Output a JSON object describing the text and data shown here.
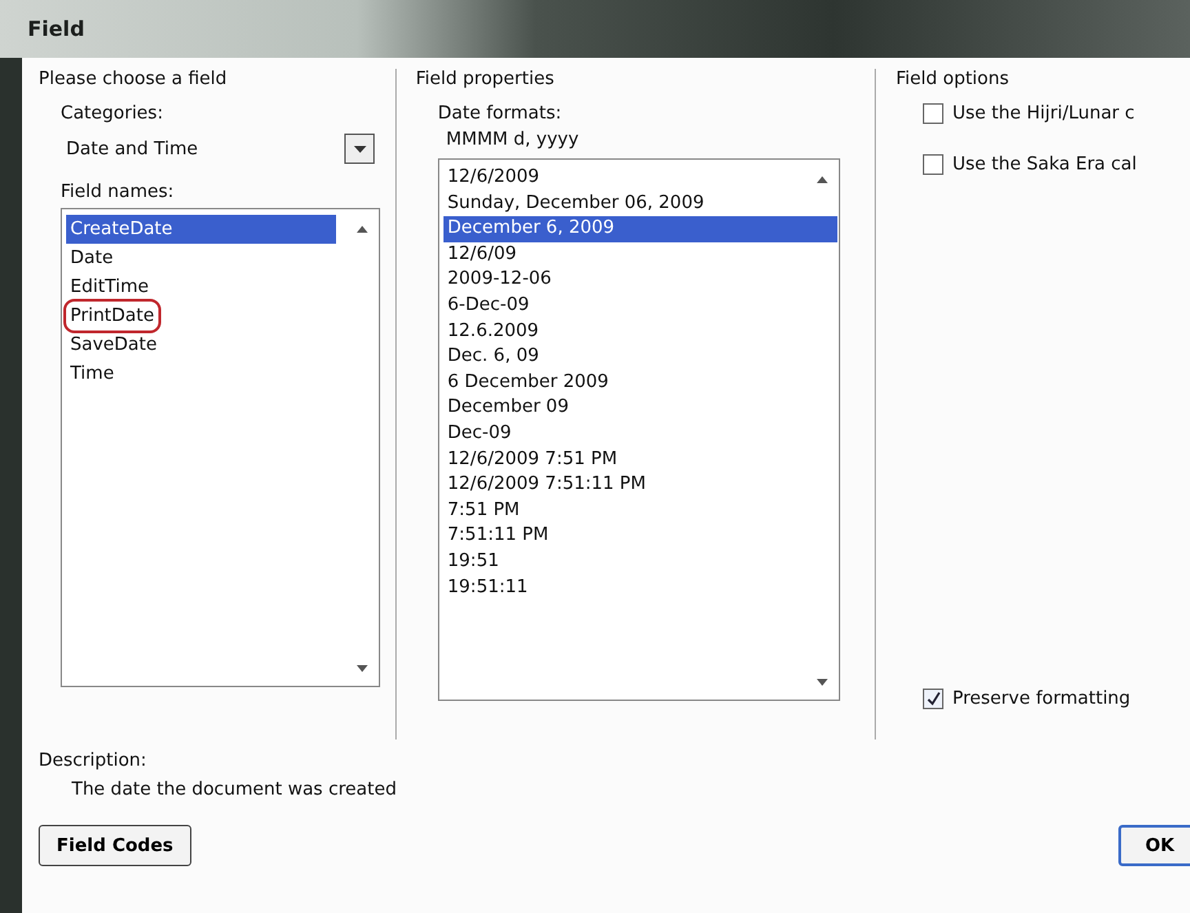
{
  "window": {
    "title": "Field"
  },
  "choose": {
    "heading": "Please choose a field",
    "categories_label": "Categories:",
    "category": "Date and Time",
    "field_names_label": "Field names:",
    "field_names": [
      {
        "label": "CreateDate",
        "selected": true,
        "highlighted": false
      },
      {
        "label": "Date",
        "selected": false,
        "highlighted": false
      },
      {
        "label": "EditTime",
        "selected": false,
        "highlighted": false
      },
      {
        "label": "PrintDate",
        "selected": false,
        "highlighted": true
      },
      {
        "label": "SaveDate",
        "selected": false,
        "highlighted": false
      },
      {
        "label": "Time",
        "selected": false,
        "highlighted": false
      }
    ]
  },
  "properties": {
    "heading": "Field properties",
    "formats_label": "Date formats:",
    "format_value": "MMMM d, yyyy",
    "formats": [
      {
        "label": "12/6/2009",
        "selected": false
      },
      {
        "label": "Sunday, December 06, 2009",
        "selected": false
      },
      {
        "label": "December 6, 2009",
        "selected": true
      },
      {
        "label": "12/6/09",
        "selected": false
      },
      {
        "label": "2009-12-06",
        "selected": false
      },
      {
        "label": "6-Dec-09",
        "selected": false
      },
      {
        "label": "12.6.2009",
        "selected": false
      },
      {
        "label": "Dec. 6, 09",
        "selected": false
      },
      {
        "label": "6 December 2009",
        "selected": false
      },
      {
        "label": "December 09",
        "selected": false
      },
      {
        "label": "Dec-09",
        "selected": false
      },
      {
        "label": "12/6/2009 7:51 PM",
        "selected": false
      },
      {
        "label": "12/6/2009 7:51:11 PM",
        "selected": false
      },
      {
        "label": "7:51 PM",
        "selected": false
      },
      {
        "label": "7:51:11 PM",
        "selected": false
      },
      {
        "label": "19:51",
        "selected": false
      },
      {
        "label": "19:51:11",
        "selected": false
      }
    ]
  },
  "options": {
    "heading": "Field options",
    "items": [
      {
        "label": "Use the Hijri/Lunar c",
        "checked": false
      },
      {
        "label": "Use the Saka Era cal",
        "checked": false
      }
    ],
    "preserve": {
      "label": "Preserve formatting",
      "checked": true
    }
  },
  "description": {
    "label": "Description:",
    "text": "The date the document was created"
  },
  "buttons": {
    "field_codes": "Field Codes",
    "ok": "OK"
  }
}
